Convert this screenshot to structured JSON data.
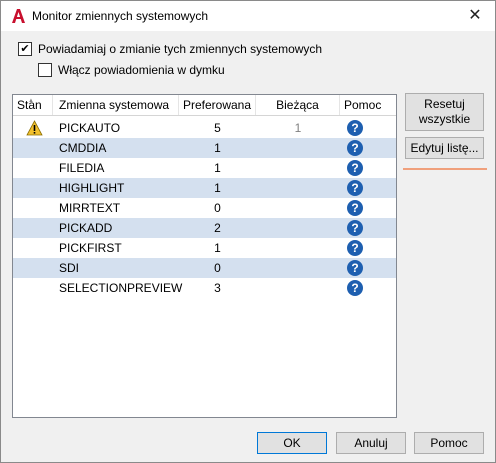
{
  "window": {
    "title": "Monitor zmiennych systemowych",
    "close_symbol": "✕"
  },
  "options": {
    "notify_label": "Powiadamiaj o zmianie tych zmiennych systemowych",
    "notify_checked": true,
    "balloon_label": "Włącz powiadomienia w dymku",
    "balloon_checked": false
  },
  "table": {
    "columns": [
      "Stan",
      "Zmienna systemowa",
      "Preferowana",
      "Bieżąca",
      "Pomoc"
    ],
    "rows": [
      {
        "status": "warning-icon",
        "name": "PICKAUTO",
        "preferred": "5",
        "current": "1"
      },
      {
        "status": "",
        "name": "CMDDIA",
        "preferred": "1",
        "current": ""
      },
      {
        "status": "",
        "name": "FILEDIA",
        "preferred": "1",
        "current": ""
      },
      {
        "status": "",
        "name": "HIGHLIGHT",
        "preferred": "1",
        "current": ""
      },
      {
        "status": "",
        "name": "MIRRTEXT",
        "preferred": "0",
        "current": ""
      },
      {
        "status": "",
        "name": "PICKADD",
        "preferred": "2",
        "current": ""
      },
      {
        "status": "",
        "name": "PICKFIRST",
        "preferred": "1",
        "current": ""
      },
      {
        "status": "",
        "name": "SDI",
        "preferred": "0",
        "current": ""
      },
      {
        "status": "",
        "name": "SELECTIONPREVIEW",
        "preferred": "3",
        "current": ""
      }
    ]
  },
  "buttons": {
    "reset_all_line1": "Resetuj",
    "reset_all_line2": "wszystkie",
    "edit_list": "Edytuj listę...",
    "ok": "OK",
    "cancel": "Anuluj",
    "help": "Pomoc"
  },
  "colors": {
    "alt_row": "#d4e0ef",
    "help_icon": "#1e5fb0",
    "warning": "#f2c12e",
    "app_icon": "#c8102e"
  }
}
